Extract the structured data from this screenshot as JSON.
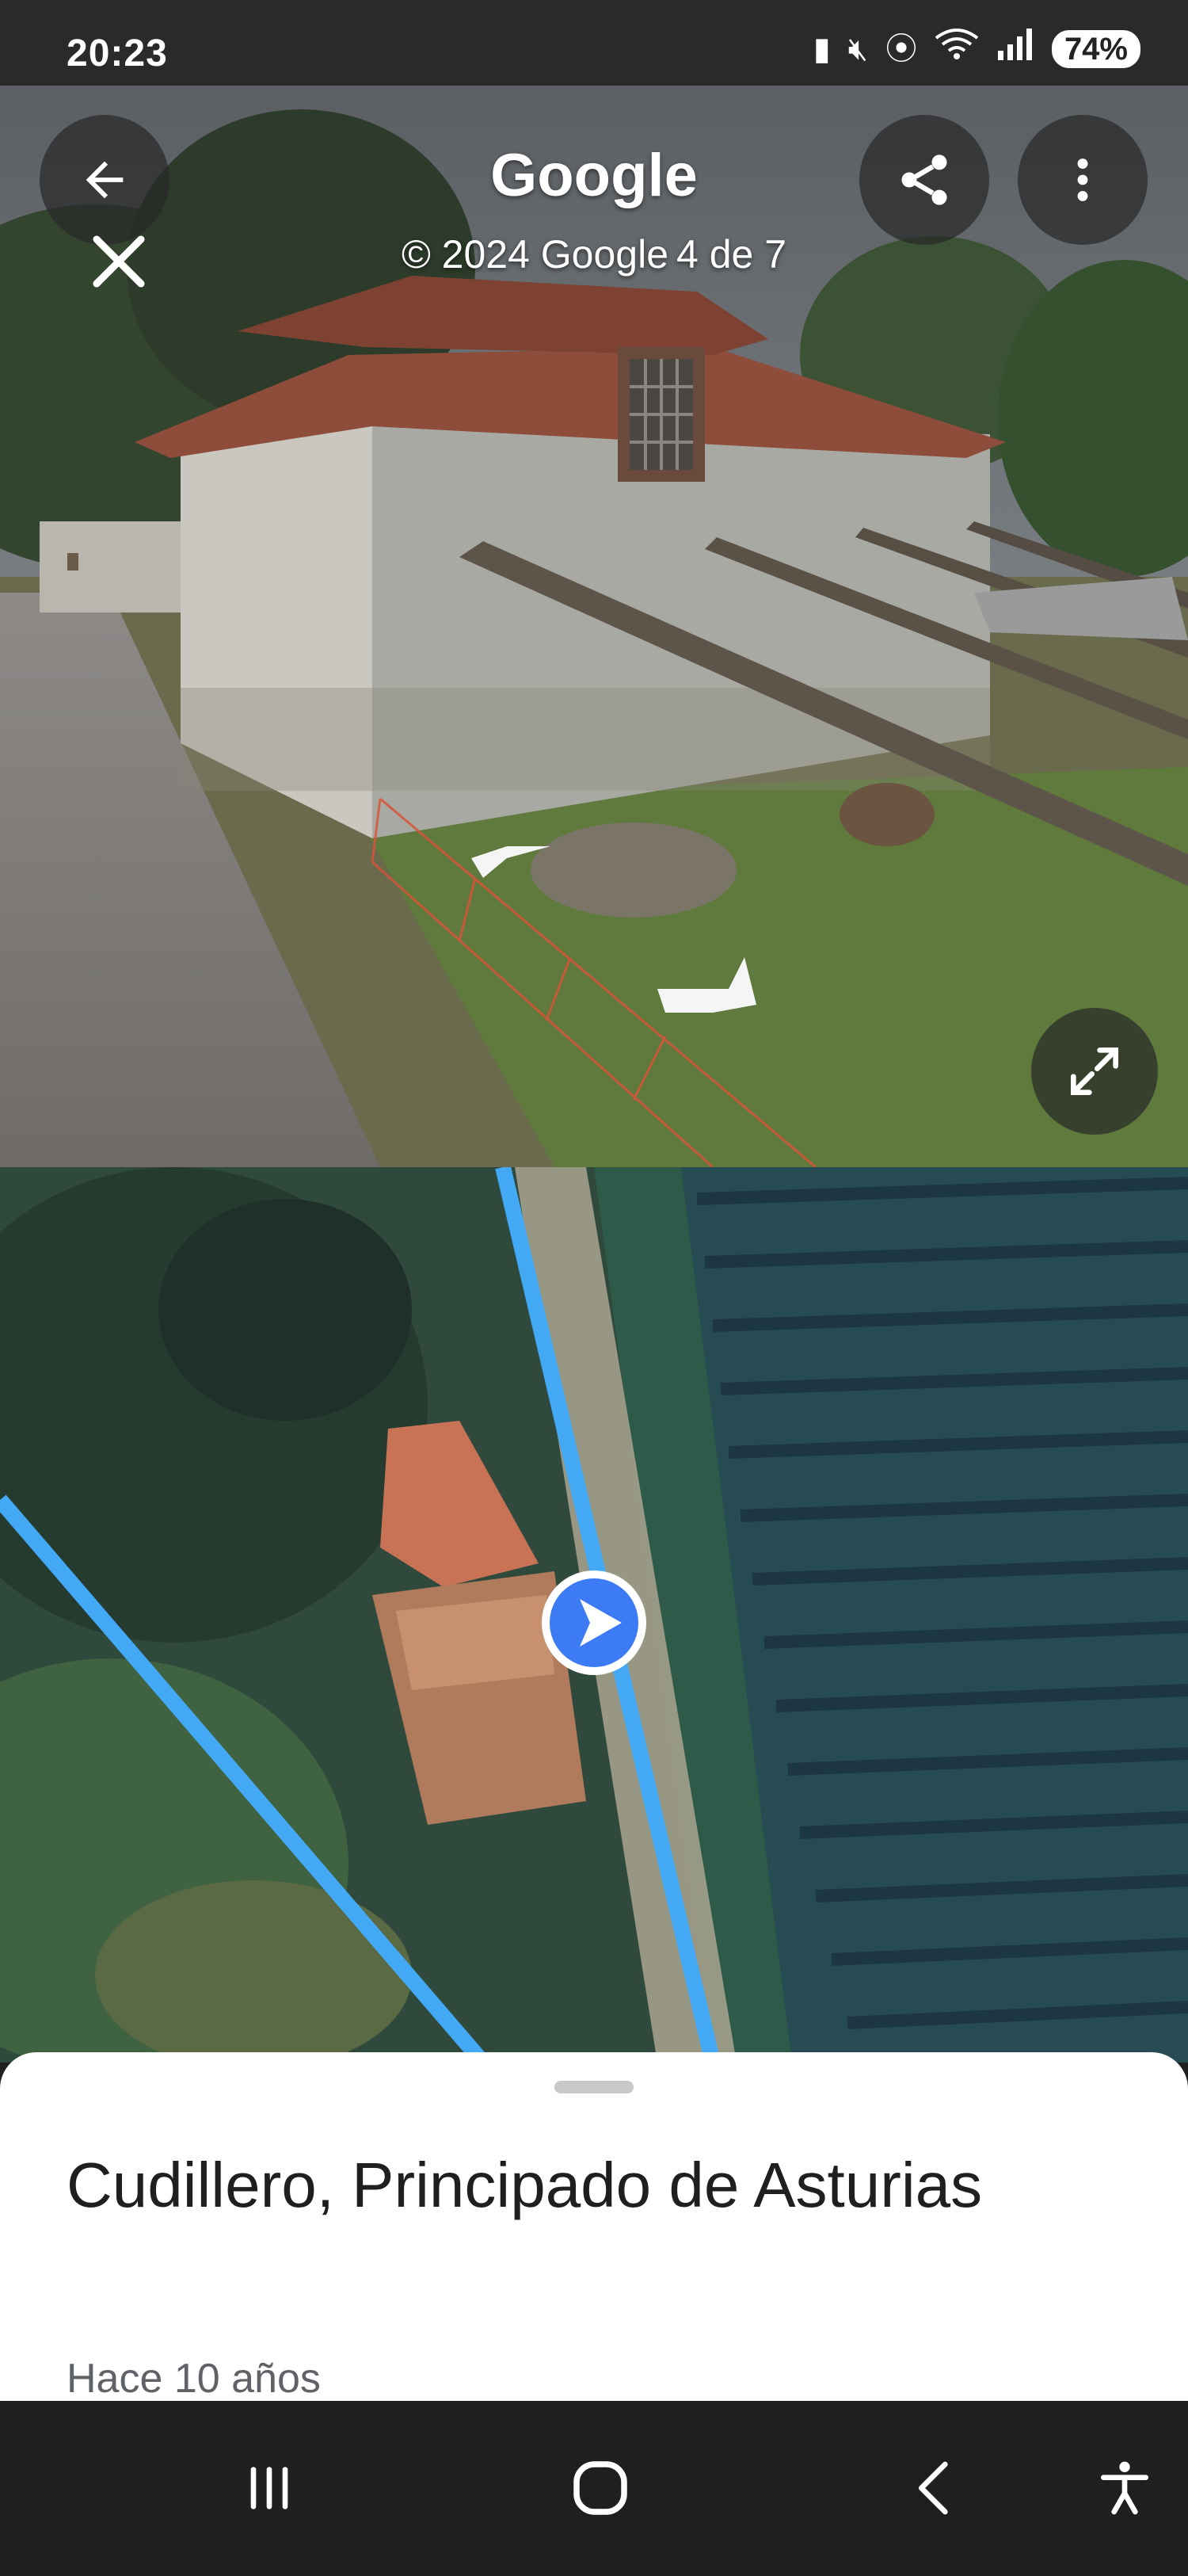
{
  "status_bar": {
    "time": "20:23",
    "battery": "74%",
    "icons": [
      "battery-saver-icon",
      "mute-icon",
      "location-icon",
      "wifi-icon",
      "signal-icon"
    ]
  },
  "street_view": {
    "title": "Google",
    "copyright": "© 2024 Google",
    "photo_index": "4 de 7",
    "buttons": [
      "back-icon",
      "close-icon",
      "share-icon",
      "more-vert-icon",
      "fullscreen-icon"
    ]
  },
  "map": {
    "route_color": "#43a9f5",
    "marker_color": "#3d7bf5"
  },
  "place": {
    "title": "Cudillero, Principado de Asturias",
    "date": "Hace 10 años"
  },
  "nav_bar": {
    "buttons": [
      "recents-icon",
      "home-icon",
      "back-nav-icon",
      "accessibility-icon"
    ]
  }
}
